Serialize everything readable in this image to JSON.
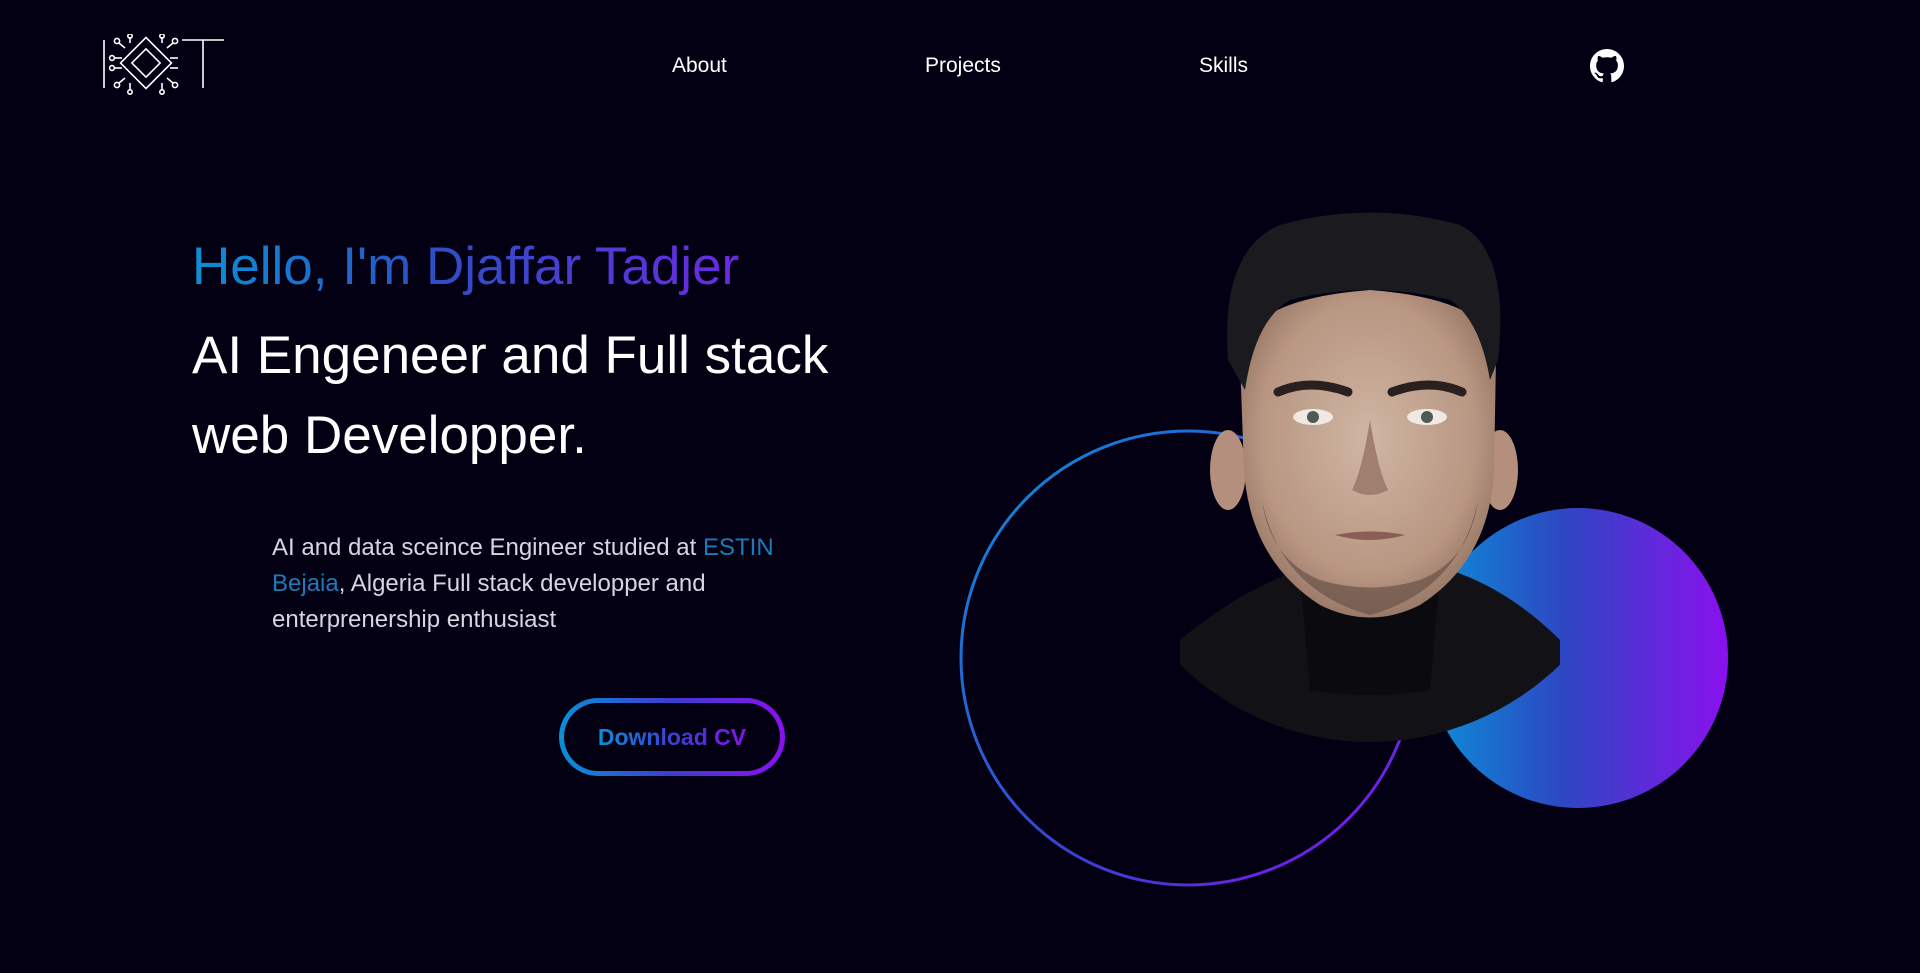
{
  "nav": {
    "logo_icon": "iot-chip-logo",
    "links": [
      "About",
      "Projects",
      "Skills"
    ],
    "github_icon": "github-icon"
  },
  "hero": {
    "greeting": "Hello, I'm Djaffar Tadjer",
    "role_line1": "AI Engeneer and Full stack",
    "role_line2": "web Developper.",
    "desc_part1": "AI and data sceince Engineer studied at ",
    "desc_link": "ESTIN Bejaia",
    "desc_part2": ", Algeria Full stack developper and enterprenership enthusiast",
    "cv_button": "Download CV"
  },
  "colors": {
    "background": "#030014",
    "gradient_start": "#0b8fd6",
    "gradient_mid": "#3f3bd0",
    "gradient_end": "#8a10ee",
    "accent_link": "#1d7ab8"
  }
}
